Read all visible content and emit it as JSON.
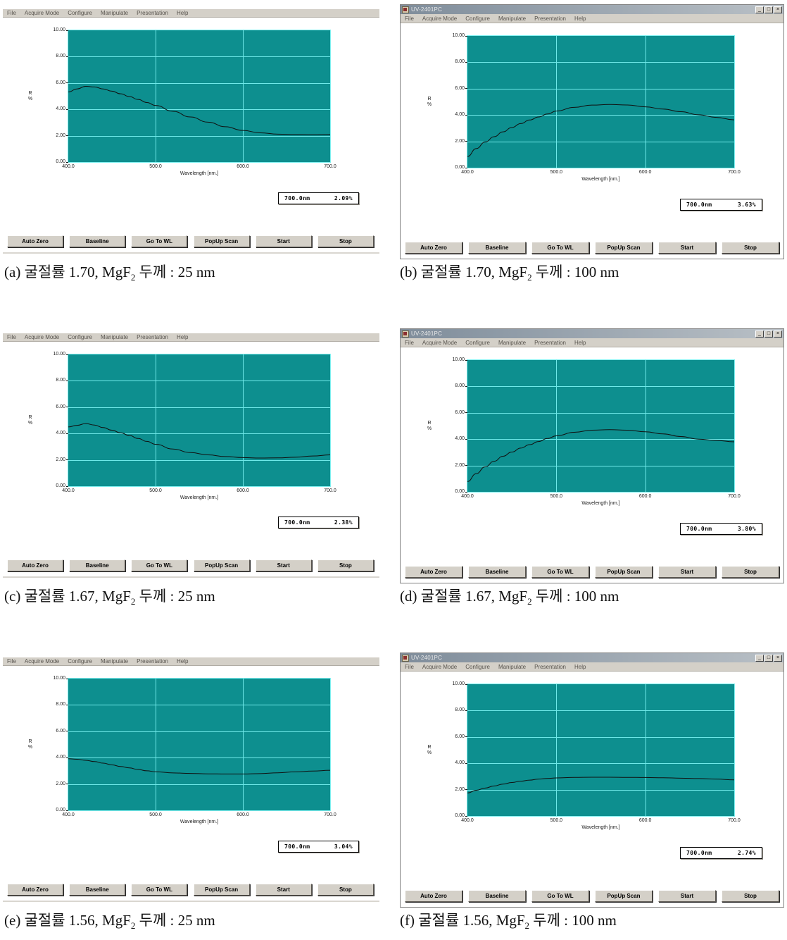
{
  "figure": {
    "axis": {
      "ylabel_line1": "R",
      "ylabel_line2": "%",
      "xlabel": "Wavelength [nm.]",
      "yticks": [
        "10.00",
        "8.00",
        "6.00",
        "4.00",
        "2.00",
        "0.00"
      ],
      "xticks": [
        "400.0",
        "500.0",
        "600.0",
        "700.0"
      ],
      "plot_bg": "#0d8f8f",
      "grid_color": "#6fe9e9",
      "trace_color": "#101010"
    },
    "window": {
      "title": "UV-2401PC",
      "menu": [
        "File",
        "Acquire Mode",
        "Configure",
        "Manipulate",
        "Presentation",
        "Help"
      ],
      "minimize_label": "_",
      "maximize_label": "□",
      "close_label": "×"
    },
    "buttons": [
      "Auto Zero",
      "Baseline",
      "Go To WL",
      "PopUp Scan",
      "Start",
      "Stop"
    ],
    "panels": [
      {
        "id": "a",
        "caption_prefix": "(a)",
        "caption_text1": "굴절률 1.70, MgF",
        "caption_sub": "2",
        "caption_text2": "두께 : 25 nm",
        "readout_wavelength": "700.0nm",
        "readout_value": "2.09%",
        "has_titlebar": false
      },
      {
        "id": "b",
        "caption_prefix": "(b)",
        "caption_text1": "굴절률 1.70, MgF",
        "caption_sub": "2",
        "caption_text2": "두께 : 100 nm",
        "readout_wavelength": "700.0nm",
        "readout_value": "3.63%",
        "has_titlebar": true
      },
      {
        "id": "c",
        "caption_prefix": "(c)",
        "caption_text1": "굴절률 1.67, MgF",
        "caption_sub": "2",
        "caption_text2": "두께 : 25 nm",
        "readout_wavelength": "700.0nm",
        "readout_value": "2.38%",
        "has_titlebar": false
      },
      {
        "id": "d",
        "caption_prefix": "(d)",
        "caption_text1": "굴절률 1.67, MgF",
        "caption_sub": "2",
        "caption_text2": "두께 : 100 nm",
        "readout_wavelength": "700.0nm",
        "readout_value": "3.80%",
        "has_titlebar": true
      },
      {
        "id": "e",
        "caption_prefix": "(e)",
        "caption_text1": "굴절률 1.56, MgF",
        "caption_sub": "2",
        "caption_text2": "두께 : 25 nm",
        "readout_wavelength": "700.0nm",
        "readout_value": "3.04%",
        "has_titlebar": false
      },
      {
        "id": "f",
        "caption_prefix": "(f)",
        "caption_text1": "굴절률 1.56, MgF",
        "caption_sub": "2",
        "caption_text2": "두께 : 100 nm",
        "readout_wavelength": "700.0nm",
        "readout_value": "2.74%",
        "has_titlebar": true
      }
    ]
  },
  "chart_data": [
    {
      "type": "line",
      "panel": "a",
      "title": "(a) 굴절률 1.70, MgF2 두께 : 25 nm",
      "xlabel": "Wavelength [nm.]",
      "ylabel": "R %",
      "xlim": [
        400,
        700
      ],
      "ylim": [
        0,
        10
      ],
      "grid": true,
      "x": [
        400,
        410,
        420,
        430,
        440,
        450,
        460,
        470,
        480,
        490,
        500,
        520,
        540,
        560,
        580,
        600,
        620,
        640,
        660,
        680,
        700
      ],
      "y": [
        5.32,
        5.55,
        5.75,
        5.7,
        5.55,
        5.38,
        5.18,
        4.97,
        4.75,
        4.52,
        4.3,
        3.85,
        3.42,
        3.03,
        2.68,
        2.4,
        2.22,
        2.12,
        2.09,
        2.08,
        2.09
      ],
      "annotation": "700.0nm  2.09%"
    },
    {
      "type": "line",
      "panel": "b",
      "title": "(b) 굴절률 1.70, MgF2 두께 : 100 nm",
      "xlabel": "Wavelength [nm.]",
      "ylabel": "R %",
      "xlim": [
        400,
        700
      ],
      "ylim": [
        0,
        10
      ],
      "grid": true,
      "x": [
        400,
        410,
        420,
        430,
        440,
        450,
        460,
        470,
        480,
        490,
        500,
        520,
        540,
        560,
        580,
        600,
        620,
        640,
        660,
        680,
        700
      ],
      "y": [
        0.85,
        1.45,
        1.95,
        2.35,
        2.72,
        3.05,
        3.35,
        3.62,
        3.85,
        4.08,
        4.3,
        4.58,
        4.75,
        4.8,
        4.76,
        4.62,
        4.45,
        4.25,
        4.02,
        3.82,
        3.63
      ],
      "annotation": "700.0nm  3.63%"
    },
    {
      "type": "line",
      "panel": "c",
      "title": "(c) 굴절률 1.67, MgF2 두께 : 25 nm",
      "xlabel": "Wavelength [nm.]",
      "ylabel": "R %",
      "xlim": [
        400,
        700
      ],
      "ylim": [
        0,
        10
      ],
      "grid": true,
      "x": [
        400,
        410,
        420,
        430,
        440,
        450,
        460,
        470,
        480,
        490,
        500,
        520,
        540,
        560,
        580,
        600,
        620,
        640,
        660,
        680,
        700
      ],
      "y": [
        4.5,
        4.62,
        4.75,
        4.64,
        4.45,
        4.25,
        4.05,
        3.85,
        3.62,
        3.4,
        3.18,
        2.82,
        2.55,
        2.38,
        2.25,
        2.17,
        2.14,
        2.15,
        2.2,
        2.29,
        2.38
      ],
      "annotation": "700.0nm  2.38%"
    },
    {
      "type": "line",
      "panel": "d",
      "title": "(d) 굴절률 1.67, MgF2 두께 : 100 nm",
      "xlabel": "Wavelength [nm.]",
      "ylabel": "R %",
      "xlim": [
        400,
        700
      ],
      "ylim": [
        0,
        10
      ],
      "grid": true,
      "x": [
        400,
        410,
        420,
        430,
        440,
        450,
        460,
        470,
        480,
        490,
        500,
        520,
        540,
        560,
        580,
        600,
        620,
        640,
        660,
        680,
        700
      ],
      "y": [
        0.78,
        1.38,
        1.9,
        2.32,
        2.7,
        3.02,
        3.32,
        3.58,
        3.82,
        4.05,
        4.25,
        4.52,
        4.68,
        4.72,
        4.68,
        4.56,
        4.4,
        4.2,
        4.0,
        3.9,
        3.8
      ],
      "annotation": "700.0nm  3.80%"
    },
    {
      "type": "line",
      "panel": "e",
      "title": "(e) 굴절률 1.56, MgF2 두께 : 25 nm",
      "xlabel": "Wavelength [nm.]",
      "ylabel": "R %",
      "xlim": [
        400,
        700
      ],
      "ylim": [
        0,
        10
      ],
      "grid": true,
      "x": [
        400,
        410,
        420,
        430,
        440,
        450,
        460,
        470,
        480,
        490,
        500,
        520,
        540,
        560,
        580,
        600,
        620,
        640,
        660,
        680,
        700
      ],
      "y": [
        3.92,
        3.88,
        3.8,
        3.7,
        3.58,
        3.45,
        3.33,
        3.22,
        3.1,
        3.0,
        2.93,
        2.84,
        2.8,
        2.77,
        2.76,
        2.76,
        2.79,
        2.85,
        2.92,
        2.98,
        3.04
      ],
      "annotation": "700.0nm  3.04%"
    },
    {
      "type": "line",
      "panel": "f",
      "title": "(f) 굴절률 1.56, MgF2 두께 : 100 nm",
      "xlabel": "Wavelength [nm.]",
      "ylabel": "R %",
      "xlim": [
        400,
        700
      ],
      "ylim": [
        0,
        10
      ],
      "grid": true,
      "x": [
        400,
        410,
        420,
        430,
        440,
        450,
        460,
        470,
        480,
        490,
        500,
        520,
        540,
        560,
        580,
        600,
        620,
        640,
        660,
        680,
        700
      ],
      "y": [
        1.75,
        1.95,
        2.12,
        2.28,
        2.42,
        2.54,
        2.64,
        2.72,
        2.8,
        2.85,
        2.89,
        2.93,
        2.94,
        2.94,
        2.93,
        2.92,
        2.9,
        2.87,
        2.84,
        2.8,
        2.74
      ],
      "annotation": "700.0nm  2.74%"
    }
  ]
}
